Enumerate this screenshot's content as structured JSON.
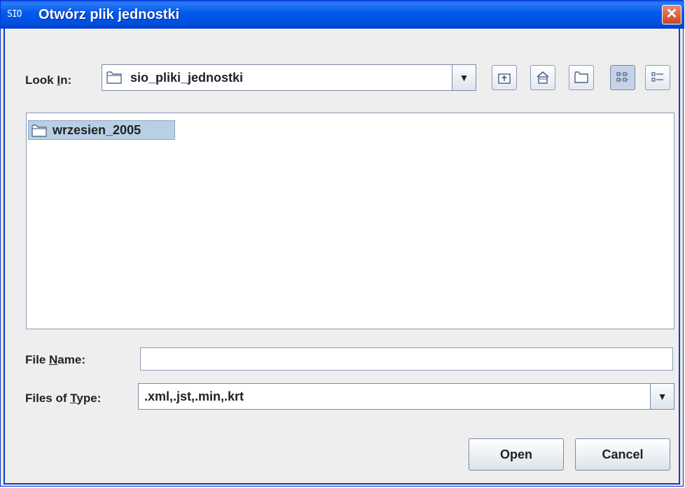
{
  "window": {
    "app_icon_text": "SIO",
    "title": "Otwórz plik jednostki",
    "close_symbol": "✕"
  },
  "look_in": {
    "label_prefix": "Look ",
    "label_mnemonic": "I",
    "label_suffix": "n:",
    "value": "sio_pliki_jednostki",
    "icon": "folder-icon"
  },
  "toolbar": {
    "buttons": [
      {
        "name": "up-one-level",
        "icon": "folder-up-icon"
      },
      {
        "name": "home",
        "icon": "home-icon"
      },
      {
        "name": "new-folder",
        "icon": "new-folder-icon"
      },
      {
        "name": "list-view",
        "icon": "list-view-icon",
        "active": true
      },
      {
        "name": "details-view",
        "icon": "details-view-icon",
        "active": false
      }
    ]
  },
  "files": [
    {
      "name": "wrzesien_2005",
      "type": "folder",
      "selected": true
    }
  ],
  "file_name": {
    "label_prefix": "File ",
    "label_mnemonic": "N",
    "label_suffix": "ame:",
    "value": ""
  },
  "file_type": {
    "label_prefix": "Files of ",
    "label_mnemonic": "T",
    "label_suffix": "ype:",
    "value": ".xml,.jst,.min,.krt"
  },
  "buttons": {
    "open": "Open",
    "cancel": "Cancel"
  },
  "colors": {
    "titlebar": "#0058ee",
    "dialog_bg": "#eeeeee",
    "selection": "#b8cfe5"
  }
}
